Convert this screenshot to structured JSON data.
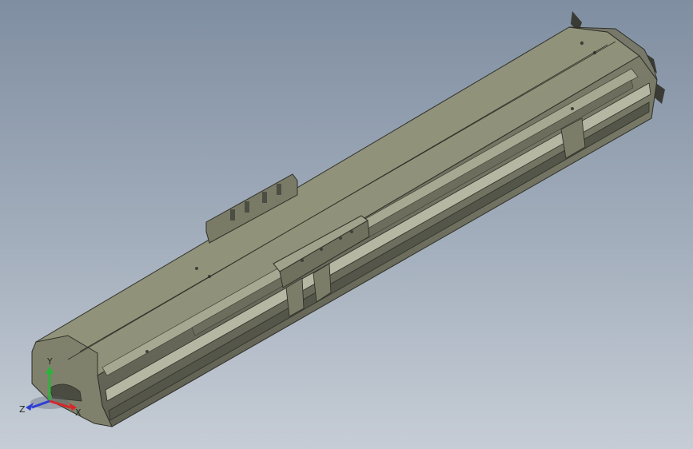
{
  "viewport": {
    "background_top": "#7f8ea1",
    "background_bottom": "#c6cdd6"
  },
  "model": {
    "body_color": "#878873",
    "top_face_color": "#8f9079",
    "side_face_color": "#6c6d5c",
    "edge_color": "#2f3028"
  },
  "triad": {
    "x_label": "X",
    "y_label": "Y",
    "z_label": "Z",
    "x_color": "#d8262a",
    "y_color": "#2bb43c",
    "z_color": "#2d3fd4"
  }
}
